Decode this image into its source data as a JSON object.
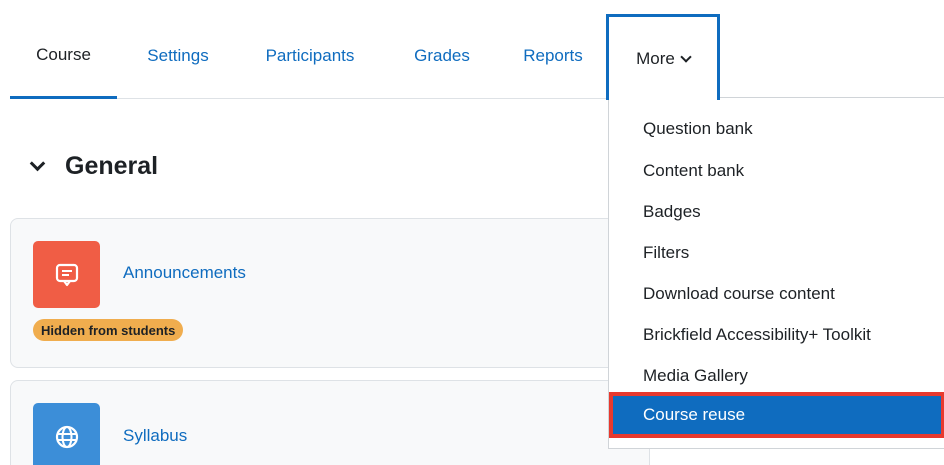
{
  "nav": {
    "tabs": [
      {
        "label": "Course",
        "active": true
      },
      {
        "label": "Settings"
      },
      {
        "label": "Participants"
      },
      {
        "label": "Grades"
      },
      {
        "label": "Reports"
      },
      {
        "label": "More",
        "expanded": true
      }
    ]
  },
  "section": {
    "title": "General"
  },
  "activities": [
    {
      "name": "Announcements",
      "icon": "forum-icon",
      "badge": "Hidden from students",
      "color": "#f05d45"
    },
    {
      "name": "Syllabus",
      "icon": "globe-icon",
      "color": "#3c8ed8"
    }
  ],
  "dropdown": {
    "items": [
      {
        "label": "Question bank"
      },
      {
        "label": "Content bank"
      },
      {
        "label": "Badges"
      },
      {
        "label": "Filters"
      },
      {
        "label": "Download course content"
      },
      {
        "label": "Brickfield Accessibility+ Toolkit"
      },
      {
        "label": "Media Gallery"
      },
      {
        "label": "Course reuse",
        "highlighted": true
      }
    ]
  },
  "colors": {
    "link": "#0f6cbf",
    "highlight_outline": "#e8392e",
    "badge": "#f0ad4e"
  }
}
